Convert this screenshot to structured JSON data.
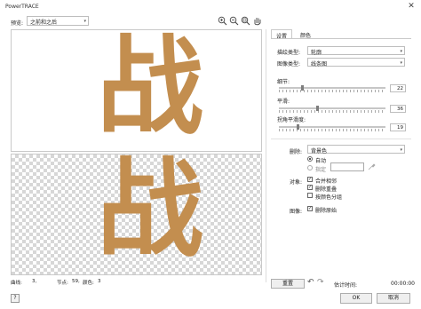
{
  "window": {
    "title": "PowerTRACE",
    "close_glyph": "✕"
  },
  "toolbar": {
    "preview_label": "预览:",
    "preview_value": "之前和之后",
    "caret": "▾"
  },
  "canvas": {
    "glyph": "战",
    "glyph_color": "#c38e4f"
  },
  "stats": {
    "curves_label": "曲线:",
    "curves_value": "3,",
    "nodes_label": "节点:",
    "nodes_value": "59,",
    "colors_label": "颜色:",
    "colors_value": "3"
  },
  "help_label": "?",
  "tabs": {
    "settings": "设置",
    "color": "颜色"
  },
  "settings": {
    "trace_type_label": "描绘类型:",
    "trace_type_value": "轮廓",
    "image_type_label": "图像类型:",
    "image_type_value": "线条图",
    "detail_label": "细节:",
    "detail_value": 22,
    "smoothing_label": "平滑:",
    "smoothing_value": 36,
    "corner_label": "拐角平滑度:",
    "corner_value": 19,
    "remove_label": "删除:",
    "remove_value": "背景色",
    "radio_auto": "自动",
    "radio_specify": "指定",
    "object_label": "对象:",
    "cb_merge": "合并相邻",
    "cb_remove_overlap": "删除重叠",
    "cb_group_by_color": "按颜色分组",
    "image_label": "图像:",
    "cb_delete_original": "删除原始"
  },
  "footer": {
    "reset": "重置",
    "undo_glyph": "↶",
    "redo_glyph": "↷",
    "est_time_label": "估计时间:",
    "est_time_value": "00:00:00",
    "ok": "OK",
    "cancel": "取消"
  }
}
